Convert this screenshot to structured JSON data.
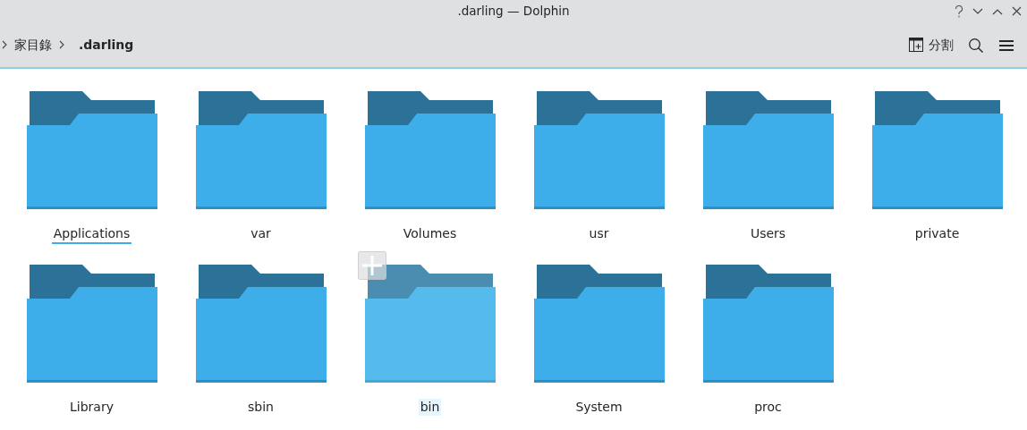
{
  "window": {
    "title": ".darling — Dolphin"
  },
  "breadcrumb": [
    {
      "label": "家目錄",
      "current": false
    },
    {
      "label": ".darling",
      "current": true
    }
  ],
  "toolbar": {
    "split_button": "分割"
  },
  "folders": [
    {
      "name": "Applications",
      "focused": true,
      "hovered": false
    },
    {
      "name": "var",
      "focused": false,
      "hovered": false
    },
    {
      "name": "Volumes",
      "focused": false,
      "hovered": false
    },
    {
      "name": "usr",
      "focused": false,
      "hovered": false
    },
    {
      "name": "Users",
      "focused": false,
      "hovered": false
    },
    {
      "name": "private",
      "focused": false,
      "hovered": false
    },
    {
      "name": "Library",
      "focused": false,
      "hovered": false
    },
    {
      "name": "sbin",
      "focused": false,
      "hovered": false
    },
    {
      "name": "bin",
      "focused": false,
      "hovered": true
    },
    {
      "name": "System",
      "focused": false,
      "hovered": false
    },
    {
      "name": "proc",
      "focused": false,
      "hovered": false
    }
  ]
}
